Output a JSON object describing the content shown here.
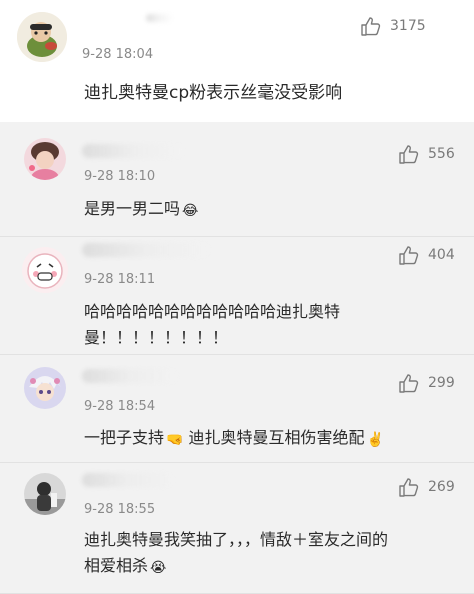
{
  "main_comment": {
    "like_count": "3175",
    "timestamp": "9-28 18:04",
    "text": "迪扎奥特曼cp粉表示丝毫没受影响"
  },
  "replies": [
    {
      "like_count": "556",
      "timestamp": "9-28 18:10",
      "lines": [
        "是男一男二吗"
      ],
      "emoji": "😂"
    },
    {
      "like_count": "404",
      "timestamp": "9-28 18:11",
      "lines": [
        "哈哈哈哈哈哈哈哈哈哈哈哈迪扎奥特",
        "曼！！！！！！！！"
      ]
    },
    {
      "like_count": "299",
      "timestamp": "9-28 18:54",
      "segments": [
        "一把子支持",
        "迪扎奥特曼互相伤害绝配"
      ],
      "emojis": [
        "🤜",
        "✌️"
      ]
    },
    {
      "like_count": "269",
      "timestamp": "9-28 18:55",
      "lines": [
        "迪扎奥特曼我笑抽了，，，情敌＋室友之间的",
        "相爱相杀"
      ],
      "emoji": "😭"
    }
  ],
  "colors": {
    "background": "#ffffff",
    "reply_background": "#f2f2f2",
    "text": "#2a2a2a",
    "meta": "#8a8a8a"
  },
  "icons": {
    "like": "thumbs-up-icon"
  }
}
